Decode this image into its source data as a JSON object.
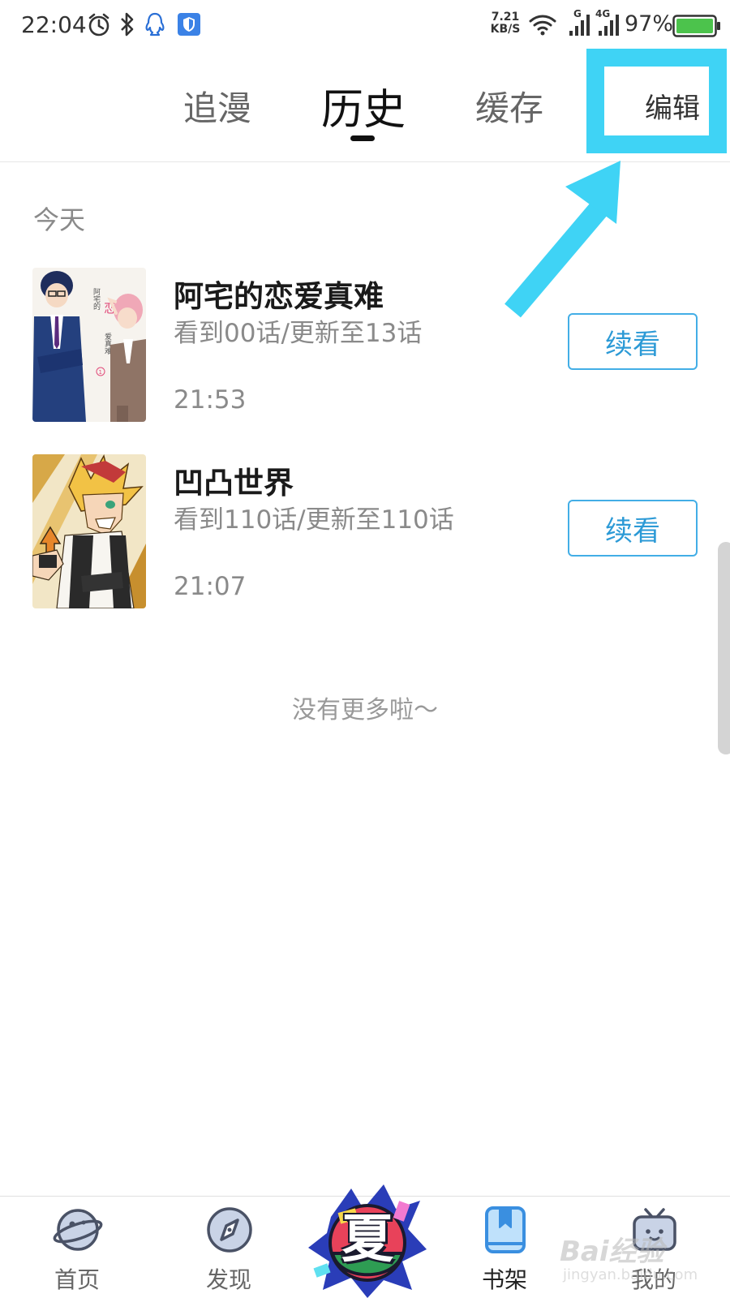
{
  "status_bar": {
    "time": "22:04",
    "net_speed_value": "7.21",
    "net_speed_unit": "KB/S",
    "network_g": "G",
    "network_4g": "4G",
    "battery": "97%",
    "icons": [
      "alarm-icon",
      "bluetooth-icon",
      "qq-icon",
      "shield-icon",
      "wifi-icon",
      "signal-icon",
      "signal-4g-icon",
      "battery-icon"
    ]
  },
  "tabs": [
    {
      "label": "追漫",
      "active": false
    },
    {
      "label": "历史",
      "active": true
    },
    {
      "label": "缓存",
      "active": false
    }
  ],
  "edit_label": "编辑",
  "annotation": {
    "highlight_color": "#3fd3f5"
  },
  "section": {
    "label": "今天"
  },
  "history": [
    {
      "title": "阿宅的恋爱真难",
      "progress": "看到00话/更新至13话",
      "time": "21:53",
      "action": "续看",
      "cover_text": "阿宅的恋 爱真难",
      "cover_volume": "1"
    },
    {
      "title": "凹凸世界",
      "progress": "看到110话/更新至110话",
      "time": "21:07",
      "action": "续看"
    }
  ],
  "footer_note": "没有更多啦～",
  "bottom_nav": [
    {
      "label": "首页",
      "icon": "planet-icon",
      "active": false
    },
    {
      "label": "发现",
      "icon": "compass-icon",
      "active": false
    },
    {
      "label": "",
      "icon": "summer-badge-icon",
      "badge_text": "夏",
      "active": false
    },
    {
      "label": "书架",
      "icon": "bookshelf-icon",
      "active": true
    },
    {
      "label": "我的",
      "icon": "tv-icon",
      "active": false
    }
  ],
  "watermark": {
    "text": "Bai经验",
    "sub": "jingyan.baidu.com"
  },
  "colors": {
    "accent_blue": "#2c9ad6",
    "nav_active": "#3a8fe0",
    "highlight": "#3fd3f5"
  }
}
